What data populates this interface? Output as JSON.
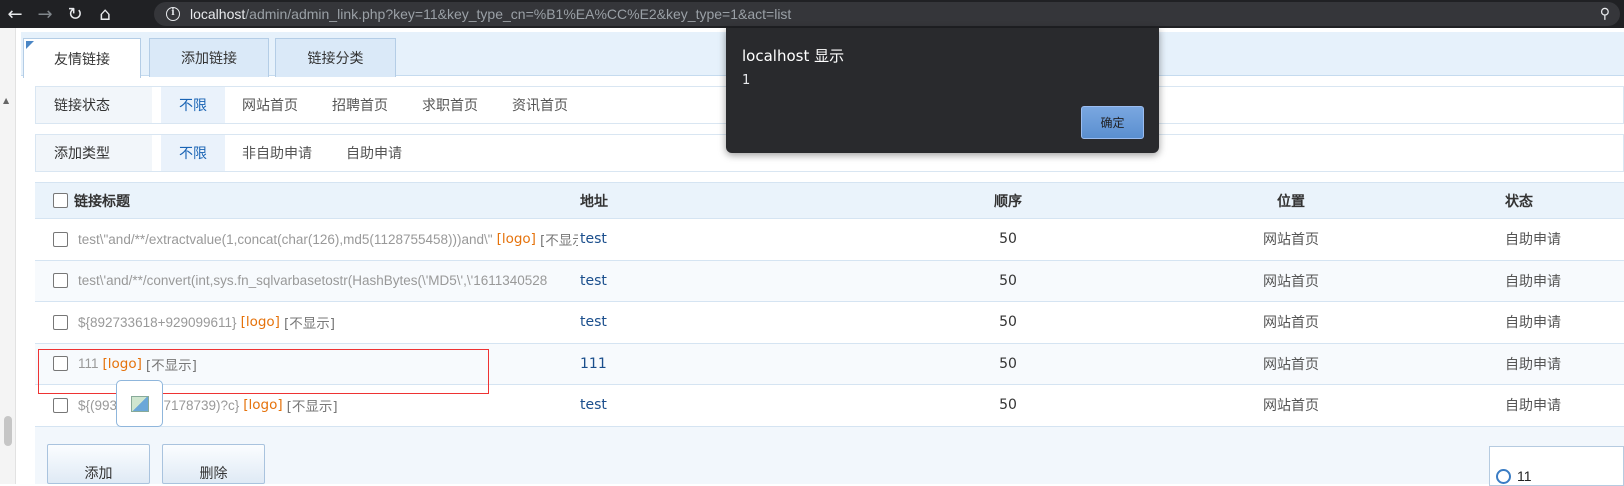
{
  "browser": {
    "url_host": "localhost",
    "url_path": "/admin/admin_link.php?key=11&key_type_cn=%B1%EA%CC%E2&key_type=1&act=list"
  },
  "tabs": [
    {
      "label": "友情链接",
      "active": true
    },
    {
      "label": "添加链接",
      "active": false
    },
    {
      "label": "链接分类",
      "active": false
    }
  ],
  "filters": {
    "status": {
      "label": "链接状态",
      "options": [
        "不限",
        "网站首页",
        "招聘首页",
        "求职首页",
        "资讯首页"
      ]
    },
    "add_type": {
      "label": "添加类型",
      "options": [
        "不限",
        "非自助申请",
        "自助申请"
      ]
    }
  },
  "table": {
    "headers": {
      "title": "链接标题",
      "addr": "地址",
      "order": "顺序",
      "position": "位置",
      "status": "状态"
    },
    "rows": [
      {
        "title": "test\\\"and/**/extractvalue(1,concat(char(126),md5(1128755458)))and\\\"",
        "logo": "[logo]",
        "hide": "[不显示]",
        "addr": "test",
        "order": "50",
        "position": "网站首页",
        "status": "自助申请"
      },
      {
        "title": "test\\'and/**/convert(int,sys.fn_sqlvarbasetostr(HashBytes(\\'MD5\\',\\'1611340528",
        "logo": "",
        "hide": "",
        "addr": "test",
        "order": "50",
        "position": "网站首页",
        "status": "自助申请"
      },
      {
        "title": "${892733618+929099611}",
        "logo": "[logo]",
        "hide": "[不显示]",
        "addr": "test",
        "order": "50",
        "position": "网站首页",
        "status": "自助申请"
      },
      {
        "title": "111",
        "logo": "[logo]",
        "hide": "[不显示]",
        "addr": "111",
        "order": "50",
        "position": "网站首页",
        "status": "自助申请"
      },
      {
        "title": "${(993",
        "title_tail": "3+907178739)?c}",
        "logo": "[logo]",
        "hide": "[不显示]",
        "addr": "test",
        "order": "50",
        "position": "网站首页",
        "status": "自助申请"
      }
    ]
  },
  "footer": {
    "add_label": "添加",
    "delete_label": "删除",
    "search_value": "11"
  },
  "dialog": {
    "title": "localhost 显示",
    "message": "1",
    "ok_label": "确定"
  }
}
